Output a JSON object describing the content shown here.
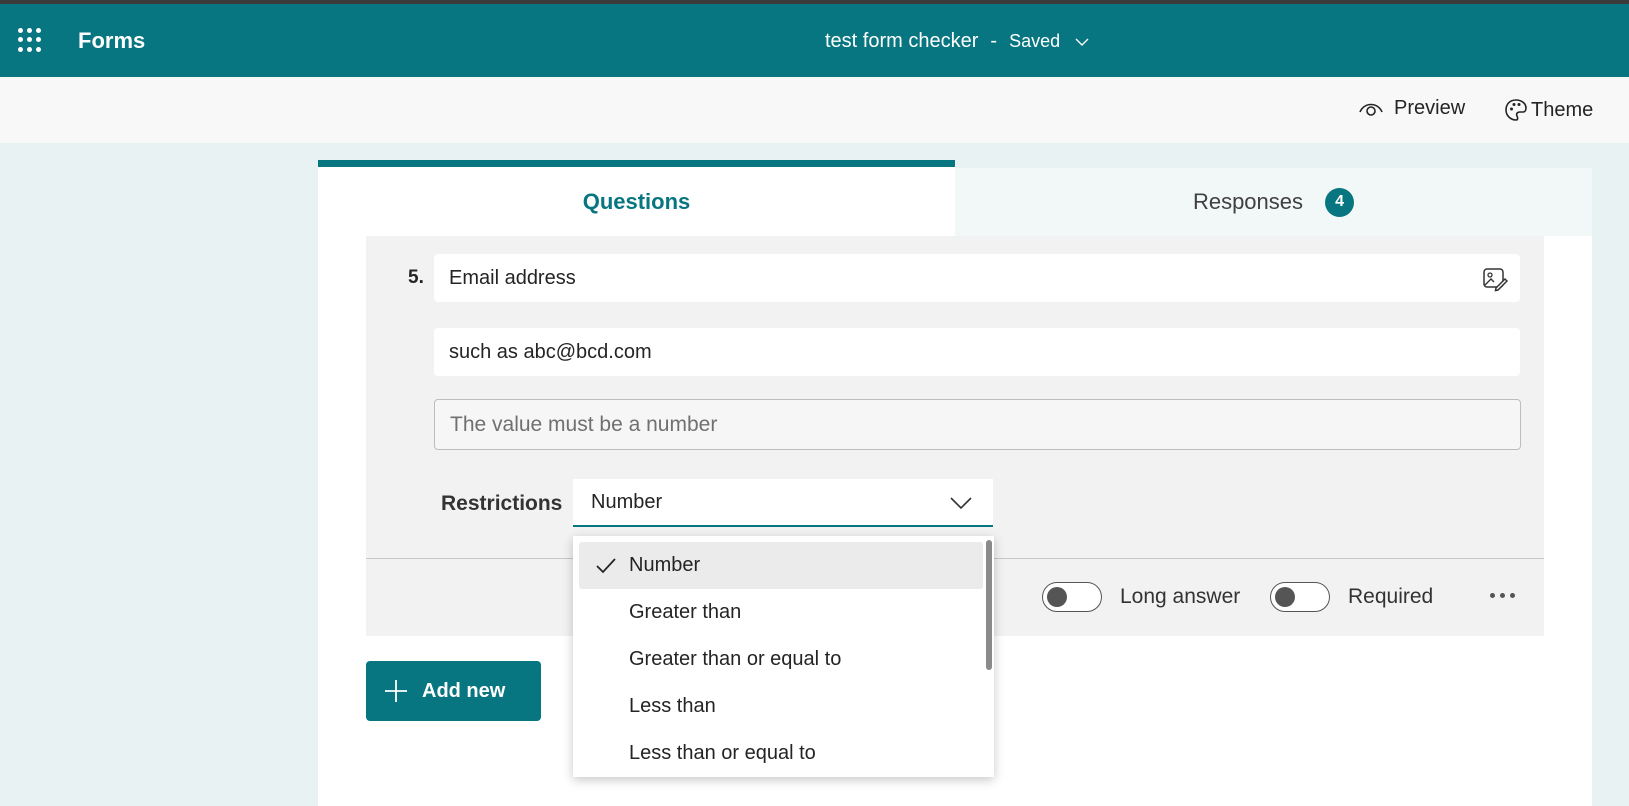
{
  "app": {
    "name": "Forms"
  },
  "document": {
    "title": "test form checker",
    "separator": "-",
    "status": "Saved"
  },
  "commands": {
    "preview": "Preview",
    "theme": "Theme"
  },
  "tabs": {
    "questions": "Questions",
    "responses": "Responses",
    "responses_count": "4"
  },
  "question": {
    "number": "5.",
    "title": "Email address",
    "subtitle": "such as abc@bcd.com",
    "error_placeholder": "The value must be a number",
    "restrictions_label": "Restrictions",
    "restriction_value": "Number"
  },
  "dropdown": {
    "options": [
      {
        "label": "Number",
        "selected": true
      },
      {
        "label": "Greater than",
        "selected": false
      },
      {
        "label": "Greater than or equal to",
        "selected": false
      },
      {
        "label": "Less than",
        "selected": false
      },
      {
        "label": "Less than or equal to",
        "selected": false
      }
    ]
  },
  "toggles": {
    "long_answer": "Long answer",
    "long_answer_on": false,
    "required": "Required",
    "required_on": false
  },
  "buttons": {
    "add_new": "Add new"
  },
  "colors": {
    "accent": "#077680",
    "page_bg": "#e8f2f3",
    "card_bg": "#f2f2f2"
  },
  "icons": [
    "app-launcher-icon",
    "chevron-down-icon",
    "eye-icon",
    "palette-icon",
    "image-edit-icon",
    "check-icon",
    "plus-icon",
    "more-icon"
  ]
}
